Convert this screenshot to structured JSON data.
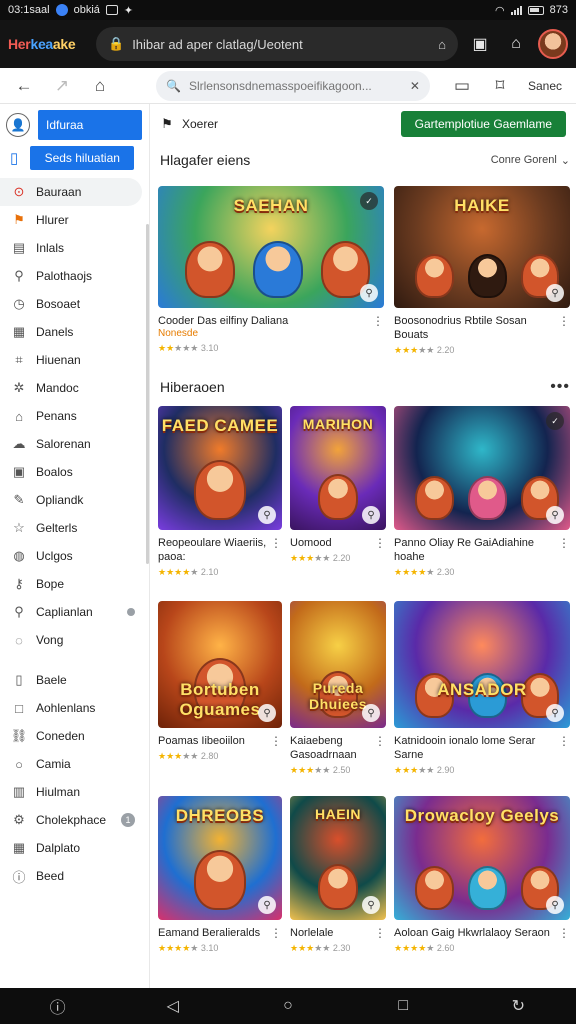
{
  "status": {
    "time": "03:1saal",
    "app": "obkiá",
    "right": "873"
  },
  "appbar": {
    "brand": [
      "Her",
      "kea",
      "ake"
    ],
    "url": "Ihibar ad aper clatlag/Ueotent"
  },
  "toolbar": {
    "search_placeholder": "Slrlensonsdnemasspoeifikagoon...",
    "right_label": "Sanec"
  },
  "sidebar": {
    "top_button": "Idfuraa",
    "second_button": "Seds hiluatian",
    "items": [
      {
        "label": "Bauraan",
        "icon": "alert-circle-icon",
        "active": true
      },
      {
        "label": "Hlurer",
        "icon": "flag-icon",
        "active": false
      },
      {
        "label": "Inlals",
        "icon": "folder-icon"
      },
      {
        "label": "Palothaojs",
        "icon": "share-icon"
      },
      {
        "label": "Bosoaet",
        "icon": "clock-icon"
      },
      {
        "label": "Danels",
        "icon": "calendar-icon"
      },
      {
        "label": "Hiuenan",
        "icon": "tag-icon"
      },
      {
        "label": "Mandoc",
        "icon": "settings-icon"
      },
      {
        "label": "Penans",
        "icon": "home-icon"
      },
      {
        "label": "Salorenan",
        "icon": "cloud-icon"
      },
      {
        "label": "Boalos",
        "icon": "box-icon"
      },
      {
        "label": "Opliandk",
        "icon": "edit-icon"
      },
      {
        "label": "Gelterls",
        "icon": "star-icon"
      },
      {
        "label": "Uclgos",
        "icon": "globe-icon"
      },
      {
        "label": "Bope",
        "icon": "key-icon"
      },
      {
        "label": "Caplianlan",
        "icon": "search-icon",
        "dot": true
      },
      {
        "label": "Vong",
        "icon": "chat-icon"
      },
      {
        "label": "Baele",
        "icon": "file-icon",
        "sepBefore": true
      },
      {
        "label": "Aohlenlans",
        "icon": "square-icon"
      },
      {
        "label": "Coneden",
        "icon": "link-icon"
      },
      {
        "label": "Camia",
        "icon": "circle-icon"
      },
      {
        "label": "Hiulman",
        "icon": "layers-icon"
      },
      {
        "label": "Cholekphace",
        "icon": "gear-icon",
        "badge": "1"
      },
      {
        "label": "Dalplato",
        "icon": "grid-icon"
      },
      {
        "label": "Beed",
        "icon": "info-icon"
      }
    ]
  },
  "strip": {
    "account": "Xoerer",
    "green_button": "Gartemplotiue Gaemlame"
  },
  "sections": {
    "s1": {
      "title": "Hlagafer eiens",
      "right": "Conre Gorenl"
    },
    "s2": {
      "title": "Hiberaoen",
      "more": "•••"
    }
  },
  "cards": [
    {
      "art": "SAEHAN",
      "title": "Cooder Das eilfiny Daliana",
      "sub": "Nonesde",
      "rating": "3.10",
      "stars": 2,
      "theme": "green"
    },
    {
      "art": "HAIKE",
      "title": "Boosonodrius Rbtile Sosan Bouats",
      "rating": "2.20",
      "stars": 3,
      "theme": "brown"
    },
    {
      "art": "FAED CAMEE",
      "title": "Reopeoulare Wiaeriis, paoa:",
      "sub": "paoa:",
      "rating": "2.10",
      "stars": 4,
      "theme": "blue"
    },
    {
      "art": "MARIHON",
      "title": "Uomood",
      "rating": "2.20",
      "stars": 3,
      "theme": "purple"
    },
    {
      "art": "",
      "title": "Panno Oliay Re GaiAdiahine hoahe",
      "rating": "2.30",
      "stars": 4,
      "theme": "night"
    },
    {
      "art": "Bortuben Oguames",
      "title": "Poamas Iibeoiilon",
      "rating": "2.80",
      "stars": 3,
      "theme": "orange"
    },
    {
      "art": "Pureda Dhuiees",
      "title": "Kaiaebeng Gasoadrnaan",
      "rating": "2.50",
      "stars": 3,
      "theme": "gold"
    },
    {
      "art": "ANSADOR",
      "title": "Katnidooin ionalo lome Serar Sarne",
      "rating": "2.90",
      "stars": 3,
      "theme": "violet"
    },
    {
      "art": "DHREOBS",
      "title": "Eamand Beralieralds",
      "rating": "3.10",
      "stars": 4,
      "theme": "sky"
    },
    {
      "art": "HAEIN",
      "title": "Norlelale",
      "rating": "2.30",
      "stars": 3,
      "theme": "teal"
    },
    {
      "art": "Drowacloy Geelys",
      "title": "Aoloan Gaig Hkwrlalaoy Seraon",
      "rating": "2.60",
      "stars": 4,
      "theme": "magenta"
    }
  ],
  "navbar": [
    "nav-help-icon",
    "back-icon",
    "home-icon",
    "recents-icon",
    "rotate-icon"
  ]
}
